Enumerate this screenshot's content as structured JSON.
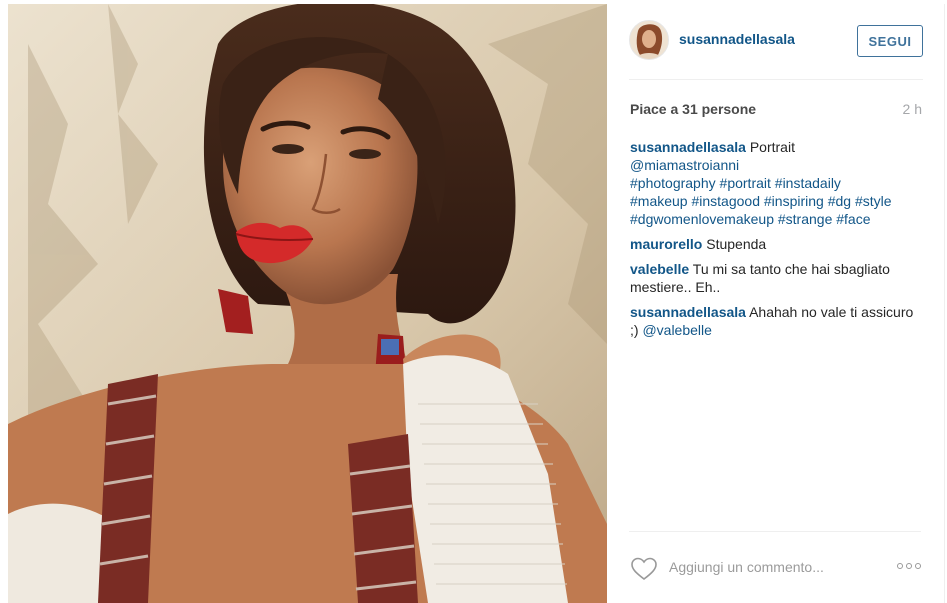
{
  "post": {
    "author": {
      "username": "susannadellasala",
      "follow_label": "SEGUI"
    },
    "likes_text": "Piace a 31 persone",
    "time_ago": "2 h",
    "comments": [
      {
        "user": "susannadellasala",
        "text": "Portrait",
        "mention": "@miamastroianni",
        "hashtags": [
          "#photography",
          "#portrait",
          "#instadaily",
          "#makeup",
          "#instagood",
          "#inspiring",
          "#dg",
          "#style",
          "#dgwomenlovemakeup",
          "#strange",
          "#face"
        ]
      },
      {
        "user": "maurorello",
        "text": "Stupenda"
      },
      {
        "user": "valebelle",
        "text": "Tu mi sa tanto che hai sbagliato mestiere.. Eh.."
      },
      {
        "user": "susannadellasala",
        "text": "Ahahah no vale ti assicuro ;)",
        "mention": "@valebelle"
      }
    ],
    "add_comment_placeholder": "Aggiungi un commento...",
    "icons": {
      "like": "heart-outline-icon",
      "more": "more-options-icon"
    },
    "colors": {
      "link": "#125688",
      "follow_border": "#3f729b",
      "muted": "#a5a7aa",
      "divider": "#efefef"
    }
  }
}
